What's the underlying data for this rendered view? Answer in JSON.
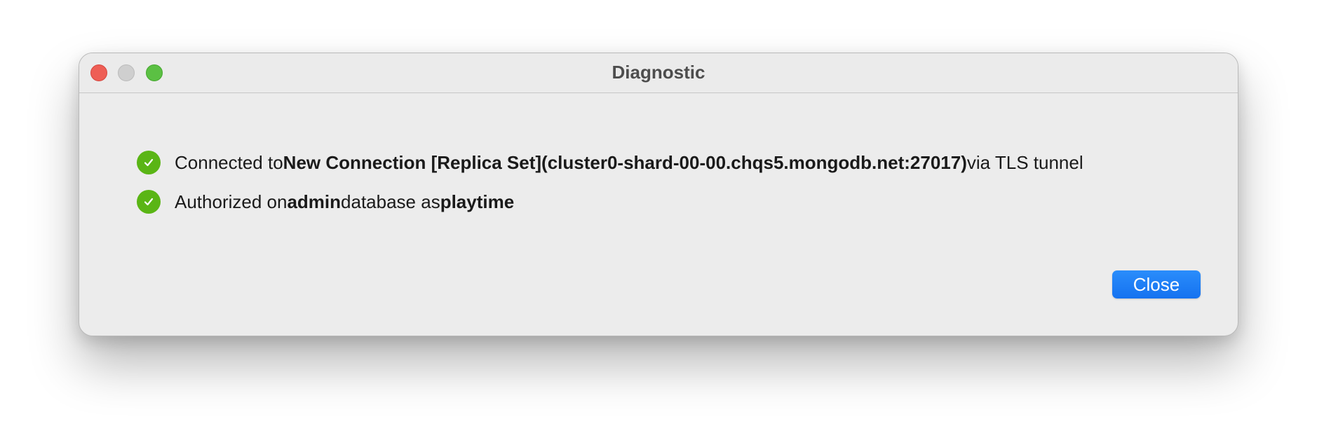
{
  "window": {
    "title": "Diagnostic"
  },
  "messages": [
    {
      "icon": "check-circle-icon",
      "icon_color": "#5ab515",
      "parts": [
        "Connected to ",
        "New Connection [Replica Set](cluster0-shard-00-00.chqs5.mongodb.net:27017)",
        " via TLS tunnel"
      ]
    },
    {
      "icon": "check-circle-icon",
      "icon_color": "#5ab515",
      "parts": [
        "Authorized on ",
        "admin",
        " database as ",
        "playtime"
      ]
    }
  ],
  "buttons": {
    "close_label": "Close",
    "close_color": "#1a7ff7"
  }
}
